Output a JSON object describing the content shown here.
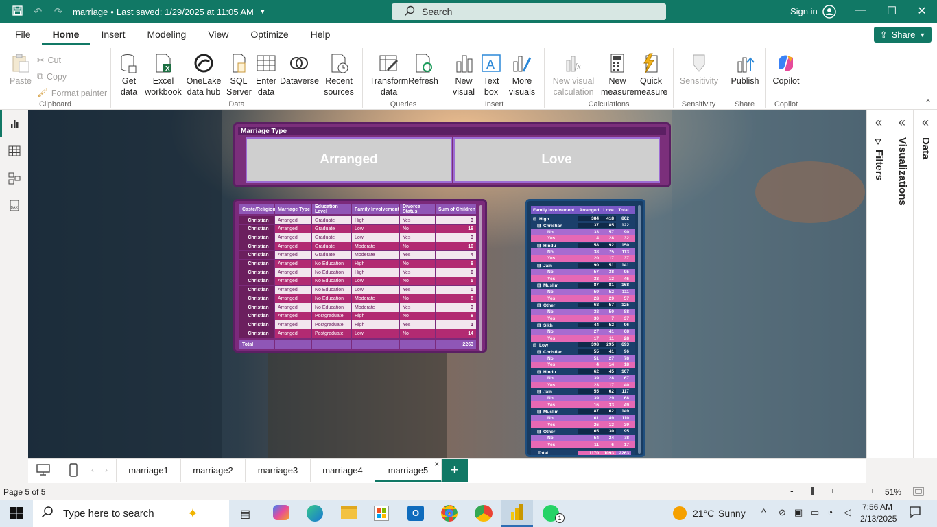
{
  "title_bar": {
    "doc_title": "marriage",
    "save_status": "Last saved: 1/29/2025 at 11:05 AM",
    "search_placeholder": "Search",
    "sign_in": "Sign in"
  },
  "menu": [
    "File",
    "Home",
    "Insert",
    "Modeling",
    "View",
    "Optimize",
    "Help"
  ],
  "share_label": "Share",
  "ribbon": {
    "clipboard": {
      "label": "Clipboard",
      "paste": "Paste",
      "cut": "Cut",
      "copy": "Copy",
      "format_painter": "Format painter"
    },
    "data": {
      "label": "Data",
      "get_data": "Get data",
      "excel": "Excel workbook",
      "onelake": "OneLake data hub",
      "sql": "SQL Server",
      "enter": "Enter data",
      "dataverse": "Dataverse",
      "recent": "Recent sources"
    },
    "queries": {
      "label": "Queries",
      "transform": "Transform data",
      "refresh": "Refresh"
    },
    "insert": {
      "label": "Insert",
      "new_visual": "New visual",
      "text_box": "Text box",
      "more_visuals": "More visuals"
    },
    "calculations": {
      "label": "Calculations",
      "new_visual_calc": "New visual calculation",
      "new_measure": "New measure",
      "quick_measure": "Quick measure"
    },
    "sensitivity": {
      "label": "Sensitivity",
      "sensitivity": "Sensitivity"
    },
    "share": {
      "label": "Share",
      "publish": "Publish"
    },
    "copilot": {
      "label": "Copilot",
      "copilot": "Copilot"
    }
  },
  "right_panes": [
    "Filters",
    "Visualizations",
    "Data"
  ],
  "slicer": {
    "title": "Marriage Type",
    "options": [
      "Arranged",
      "Love"
    ]
  },
  "table1": {
    "headers": [
      "Caste/Religion",
      "Marriage Type",
      "Education Level",
      "Family Involvement",
      "Divorce Status",
      "Sum of Children"
    ],
    "rows": [
      [
        "Christian",
        "Arranged",
        "Graduate",
        "High",
        "Yes",
        "3"
      ],
      [
        "Christian",
        "Arranged",
        "Graduate",
        "Low",
        "No",
        "18"
      ],
      [
        "Christian",
        "Arranged",
        "Graduate",
        "Low",
        "Yes",
        "3"
      ],
      [
        "Christian",
        "Arranged",
        "Graduate",
        "Moderate",
        "No",
        "10"
      ],
      [
        "Christian",
        "Arranged",
        "Graduate",
        "Moderate",
        "Yes",
        "4"
      ],
      [
        "Christian",
        "Arranged",
        "No Education",
        "High",
        "No",
        "8"
      ],
      [
        "Christian",
        "Arranged",
        "No Education",
        "High",
        "Yes",
        "0"
      ],
      [
        "Christian",
        "Arranged",
        "No Education",
        "Low",
        "No",
        "5"
      ],
      [
        "Christian",
        "Arranged",
        "No Education",
        "Low",
        "Yes",
        "0"
      ],
      [
        "Christian",
        "Arranged",
        "No Education",
        "Moderate",
        "No",
        "8"
      ],
      [
        "Christian",
        "Arranged",
        "No Education",
        "Moderate",
        "Yes",
        "3"
      ],
      [
        "Christian",
        "Arranged",
        "Postgraduate",
        "High",
        "No",
        "8"
      ],
      [
        "Christian",
        "Arranged",
        "Postgraduate",
        "High",
        "Yes",
        "1"
      ],
      [
        "Christian",
        "Arranged",
        "Postgraduate",
        "Low",
        "No",
        "14"
      ]
    ],
    "total_label": "Total",
    "total_value": "2263"
  },
  "table2": {
    "headers": [
      "Family Involvement",
      "Arranged",
      "Love",
      "Total"
    ],
    "rows": [
      {
        "lvl": 0,
        "label": "High",
        "a": "384",
        "l": "418",
        "t": "802"
      },
      {
        "lvl": 1,
        "label": "Christian",
        "a": "37",
        "l": "85",
        "t": "122"
      },
      {
        "lvl": 2,
        "label": "No",
        "a": "33",
        "l": "57",
        "t": "90"
      },
      {
        "lvl": 2,
        "label": "Yes",
        "a": "4",
        "l": "28",
        "t": "32"
      },
      {
        "lvl": 1,
        "label": "Hindu",
        "a": "58",
        "l": "92",
        "t": "150"
      },
      {
        "lvl": 2,
        "label": "No",
        "a": "38",
        "l": "75",
        "t": "113"
      },
      {
        "lvl": 2,
        "label": "Yes",
        "a": "20",
        "l": "17",
        "t": "37"
      },
      {
        "lvl": 1,
        "label": "Jain",
        "a": "90",
        "l": "51",
        "t": "141"
      },
      {
        "lvl": 2,
        "label": "No",
        "a": "57",
        "l": "38",
        "t": "95"
      },
      {
        "lvl": 2,
        "label": "Yes",
        "a": "33",
        "l": "13",
        "t": "46"
      },
      {
        "lvl": 1,
        "label": "Muslim",
        "a": "87",
        "l": "81",
        "t": "168"
      },
      {
        "lvl": 2,
        "label": "No",
        "a": "59",
        "l": "52",
        "t": "111"
      },
      {
        "lvl": 2,
        "label": "Yes",
        "a": "28",
        "l": "29",
        "t": "57"
      },
      {
        "lvl": 1,
        "label": "Other",
        "a": "68",
        "l": "57",
        "t": "125"
      },
      {
        "lvl": 2,
        "label": "No",
        "a": "38",
        "l": "50",
        "t": "88"
      },
      {
        "lvl": 2,
        "label": "Yes",
        "a": "30",
        "l": "7",
        "t": "37"
      },
      {
        "lvl": 1,
        "label": "Sikh",
        "a": "44",
        "l": "52",
        "t": "96"
      },
      {
        "lvl": 2,
        "label": "No",
        "a": "27",
        "l": "41",
        "t": "68"
      },
      {
        "lvl": 2,
        "label": "Yes",
        "a": "17",
        "l": "11",
        "t": "28"
      },
      {
        "lvl": 0,
        "label": "Low",
        "a": "398",
        "l": "295",
        "t": "693"
      },
      {
        "lvl": 1,
        "label": "Christian",
        "a": "55",
        "l": "41",
        "t": "96"
      },
      {
        "lvl": 2,
        "label": "No",
        "a": "51",
        "l": "27",
        "t": "78"
      },
      {
        "lvl": 2,
        "label": "Yes",
        "a": "4",
        "l": "14",
        "t": "18"
      },
      {
        "lvl": 1,
        "label": "Hindu",
        "a": "62",
        "l": "45",
        "t": "107"
      },
      {
        "lvl": 2,
        "label": "No",
        "a": "39",
        "l": "28",
        "t": "67"
      },
      {
        "lvl": 2,
        "label": "Yes",
        "a": "23",
        "l": "17",
        "t": "40"
      },
      {
        "lvl": 1,
        "label": "Jain",
        "a": "55",
        "l": "62",
        "t": "117"
      },
      {
        "lvl": 2,
        "label": "No",
        "a": "39",
        "l": "29",
        "t": "68"
      },
      {
        "lvl": 2,
        "label": "Yes",
        "a": "16",
        "l": "33",
        "t": "49"
      },
      {
        "lvl": 1,
        "label": "Muslim",
        "a": "87",
        "l": "62",
        "t": "149"
      },
      {
        "lvl": 2,
        "label": "No",
        "a": "61",
        "l": "49",
        "t": "110"
      },
      {
        "lvl": 2,
        "label": "Yes",
        "a": "26",
        "l": "13",
        "t": "39"
      },
      {
        "lvl": 1,
        "label": "Other",
        "a": "65",
        "l": "30",
        "t": "95"
      },
      {
        "lvl": 2,
        "label": "No",
        "a": "54",
        "l": "24",
        "t": "78"
      },
      {
        "lvl": 2,
        "label": "Yes",
        "a": "11",
        "l": "6",
        "t": "17"
      }
    ],
    "total": {
      "label": "Total",
      "a": "1170",
      "l": "1093",
      "t": "2263"
    }
  },
  "page_tabs": [
    "marriage1",
    "marriage2",
    "marriage3",
    "marriage4",
    "marriage5"
  ],
  "active_tab": "marriage5",
  "status": {
    "page": "Page 5 of 5",
    "zoom": "51%"
  },
  "taskbar": {
    "search_placeholder": "Type here to search",
    "weather_temp": "21°C",
    "weather_desc": "Sunny",
    "time": "7:56 AM",
    "date": "2/13/2025",
    "whatsapp_badge": "1"
  },
  "colors": {
    "accent": "#117865",
    "slicer_bg": "#7b2f7b",
    "table2_bg": "#183b61",
    "pink_row": "#e668b4"
  }
}
